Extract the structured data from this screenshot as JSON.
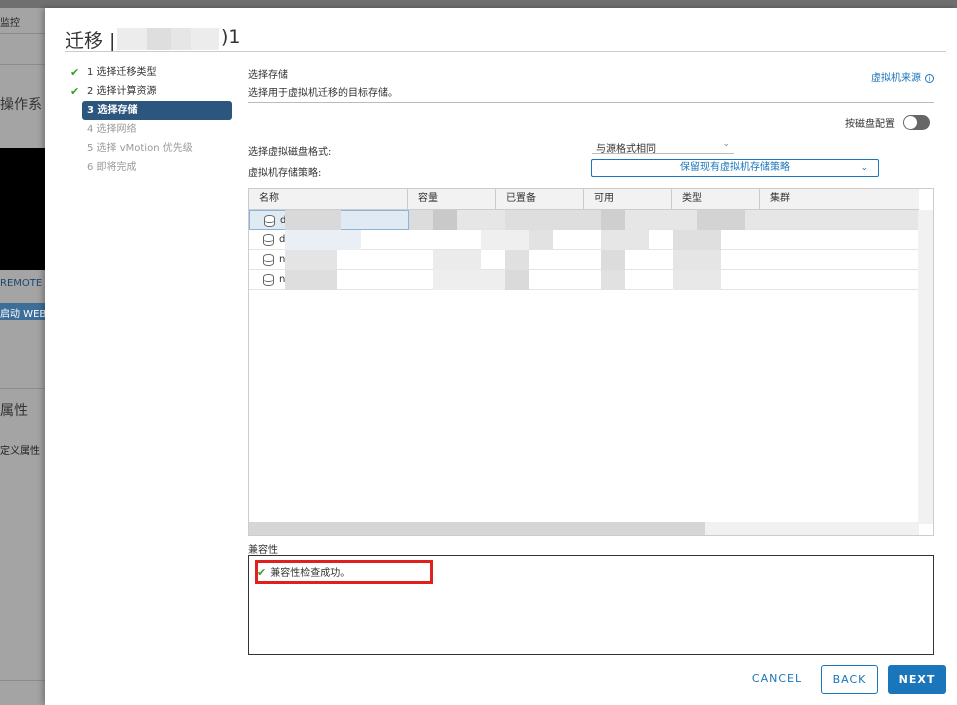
{
  "background": {
    "top_menu": "监控",
    "os_label": "操作系",
    "remote_label": "REMOTE",
    "web_button": "启动 WEB",
    "properties_label": "属性",
    "custom_attr": "定义属性"
  },
  "modal": {
    "title_prefix": "迁移 |",
    "title_suffix": ")1",
    "steps": [
      {
        "label": "1 选择迁移类型",
        "state": "done"
      },
      {
        "label": "2 选择计算资源",
        "state": "done"
      },
      {
        "label": "3 选择存储",
        "state": "active"
      },
      {
        "label": "4 选择网络",
        "state": "disabled"
      },
      {
        "label": "5 选择 vMotion 优先级",
        "state": "disabled"
      },
      {
        "label": "6 即将完成",
        "state": "disabled"
      }
    ],
    "section_title": "选择存储",
    "section_desc": "选择用于虚拟机迁移的目标存储。",
    "vm_origin_link": "虚拟机来源",
    "info_icon": "i",
    "per_disk_label": "按磁盘配置",
    "disk_format_label": "选择虚拟磁盘格式:",
    "disk_format_value": "与源格式相同",
    "storage_policy_label": "虚拟机存储策略:",
    "storage_policy_value": "保留现有虚拟机存储策略",
    "table": {
      "columns": [
        "名称",
        "容量",
        "已置备",
        "可用",
        "类型",
        "集群"
      ],
      "rows": [
        {
          "name_initial": "d"
        },
        {
          "name_initial": "d"
        },
        {
          "name_initial": "n"
        },
        {
          "name_initial": "n"
        }
      ]
    },
    "compat_title": "兼容性",
    "compat_message": "兼容性检查成功。",
    "buttons": {
      "cancel": "CANCEL",
      "back": "BACK",
      "next": "NEXT"
    }
  },
  "icons": {
    "check": "✔",
    "chevron": "⌄"
  },
  "colors": {
    "accent": "#1b75bb",
    "active_step": "#2c567e",
    "success": "#3a9c2b",
    "highlight": "#e0201d"
  }
}
